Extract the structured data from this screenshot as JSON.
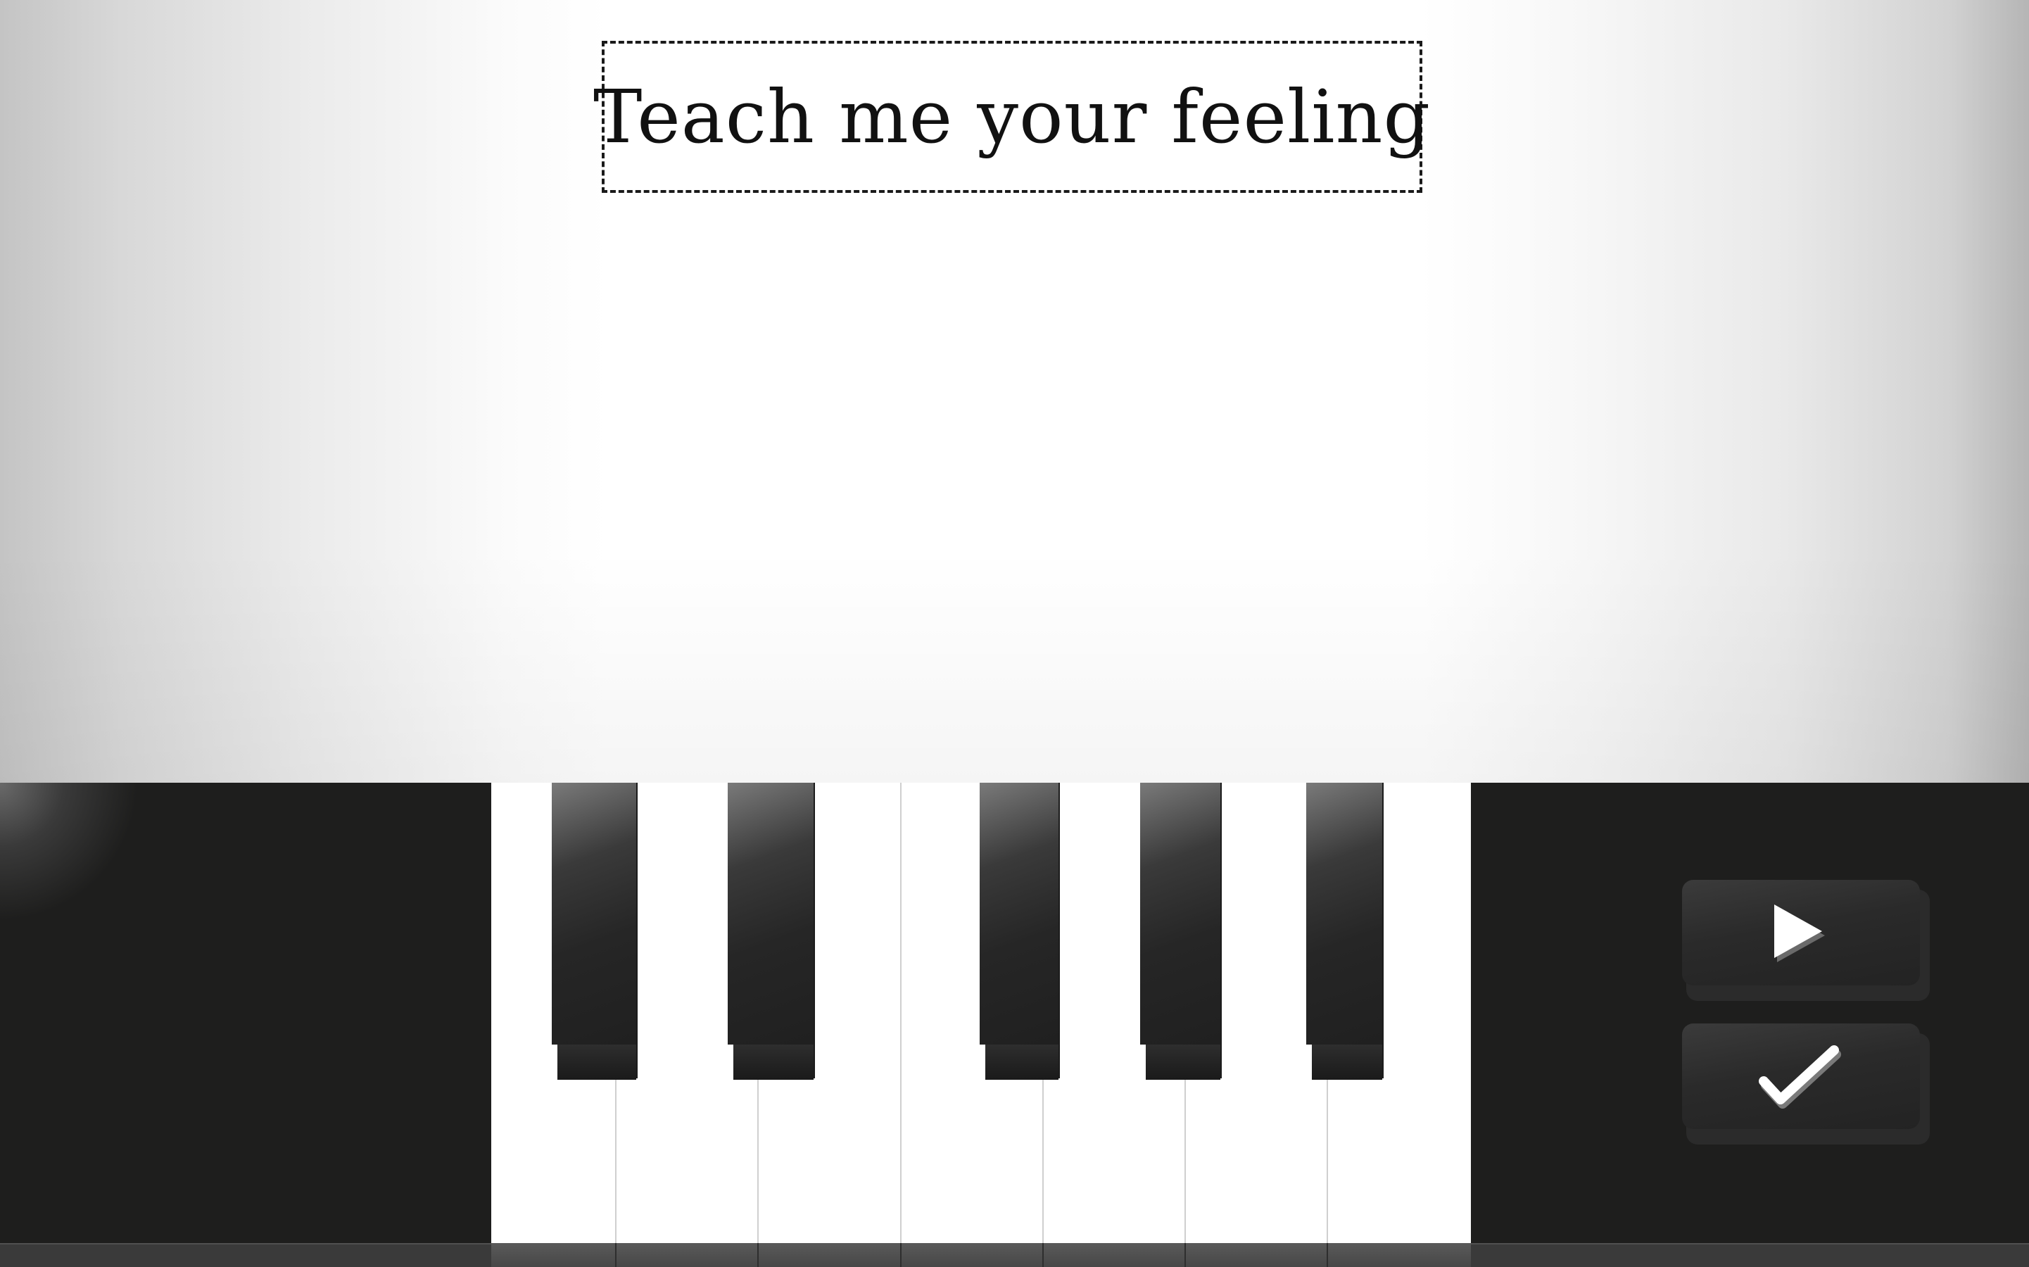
{
  "header": {
    "title": "Teach me your feeling"
  },
  "controls": {
    "play_icon": "play-icon",
    "confirm_icon": "check-icon"
  },
  "keyboard": {
    "white_key_count": 7,
    "black_key_count": 5
  },
  "colors": {
    "console": "#1e1e1d",
    "key_white": "#ffffff",
    "key_black": "#202020",
    "icon_white": "#ffffff"
  }
}
